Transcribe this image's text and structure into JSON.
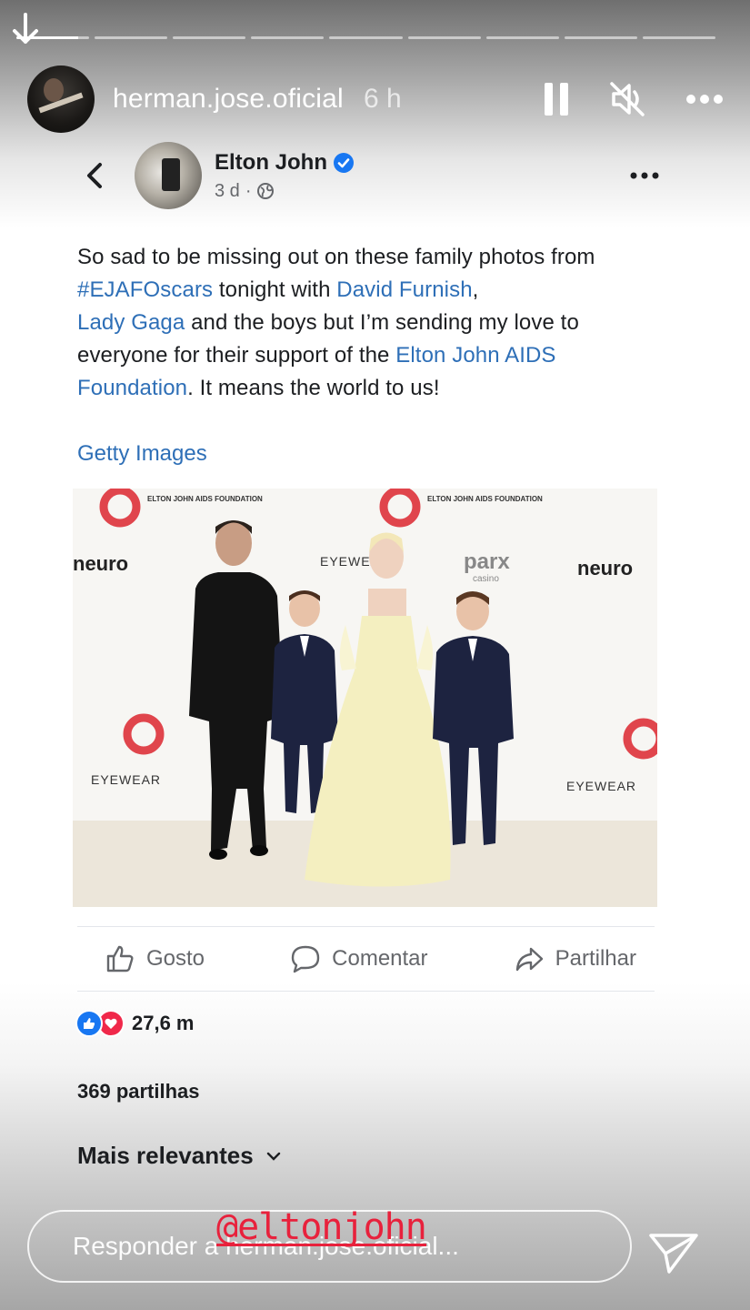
{
  "story": {
    "username": "herman.jose.oficial",
    "time": "6 h",
    "icons": {
      "dismiss": "arrow-down-icon",
      "pause": "pause-icon",
      "mute": "speaker-muted-icon",
      "more": "more-horizontal-icon"
    },
    "reply_placeholder": "Responder a herman.jose.oficial...",
    "mention_sticker": "@eltonjohn"
  },
  "post": {
    "author": "Elton John",
    "verified": true,
    "age": "3 d",
    "text_parts": {
      "t1": "So sad to be missing out on these family photos from ",
      "hashtag": "#EJAFOscars",
      "t2": " tonight with ",
      "link1": "David Furnish",
      "t3": ", ",
      "link2": "Lady Gaga",
      "t4": " and the boys but I’m sending my love to everyone for their support of the ",
      "link3": "Elton John AIDS Foundation",
      "t5": ". It means the world to us!"
    },
    "photo_credit": "Getty Images",
    "photo_backdrop_text": {
      "foundation": "ELTON JOHN AIDS FOUNDATION",
      "neuro": "neuro",
      "eyewear": "EYEWEAR",
      "parx": "parx",
      "casino": "casino"
    },
    "actions": {
      "like": "Gosto",
      "comment": "Comentar",
      "share": "Partilhar"
    },
    "reactions_count": "27,6 m",
    "shares": "369 partilhas",
    "sort_label": "Mais relevantes"
  },
  "colors": {
    "link": "#2e6fb7",
    "like_blue": "#1877f2",
    "love_red": "#f0284a",
    "mention_red": "#e8213c"
  }
}
